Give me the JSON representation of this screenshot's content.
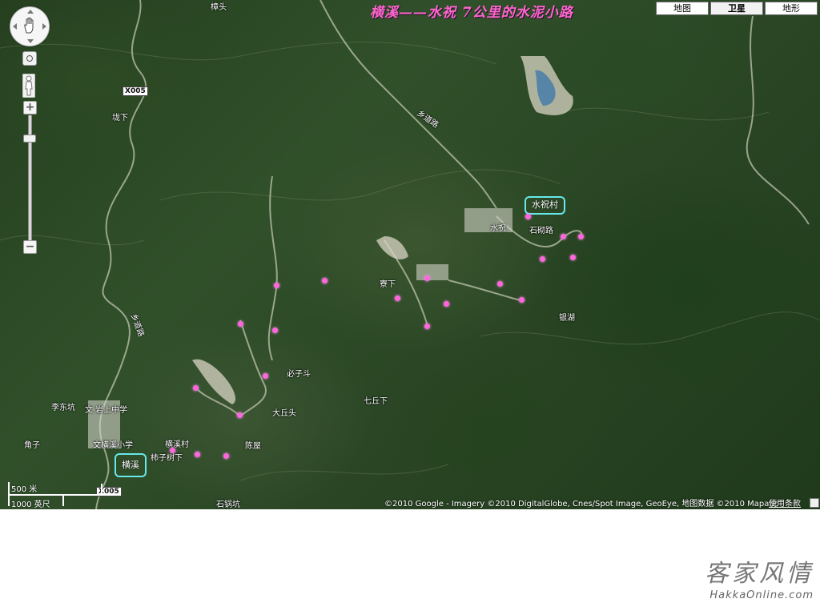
{
  "title": "横溪——水祝 7公里的水泥小路",
  "map_type_buttons": [
    "地图",
    "卫星",
    "地形"
  ],
  "active_map_type": "卫星",
  "zoom_controls": {
    "in": "+",
    "out": "−"
  },
  "scale": {
    "metric": "500 米",
    "imperial": "1000 英尺"
  },
  "road_shields": [
    "X005",
    "X005"
  ],
  "road_labels": [
    "乡道路",
    "乡道路"
  ],
  "places": {
    "top": "樟头",
    "kengxia": "垅下",
    "shuizhu": "水祝",
    "shizhaolu": "石砌路",
    "yinhu": "银湖",
    "liaoxia": "寮下",
    "bizidou": "必子斗",
    "dakoutou": "大丘头",
    "qiqiuxia": "七丘下",
    "lidongkeng": "李东坑",
    "wenyanshang": "文 岩上中学",
    "jiaozi": "角子",
    "hengxi_school": "文横溪小学",
    "hengxicun": "横溪村",
    "shizishuxia": "柿子树下",
    "chenwu": "陈屋",
    "shiguokeng": "石锅坑"
  },
  "circled_places": {
    "shuizhucun": "水祝村",
    "hengxi": "横溪"
  },
  "copyright": "©2010 Google - Imagery ©2010 DigitalGlobe, Cnes/Spot Image, GeoEye, 地图数据 ©2010 Mapabc -",
  "terms_link": "使用条款",
  "brand": {
    "chinese": "客家风情",
    "url": "HakkaOnline.com"
  },
  "colors": {
    "route_marker": "#ff66dd",
    "title": "#ff66cc",
    "highlight_ring": "#66e8ec"
  }
}
